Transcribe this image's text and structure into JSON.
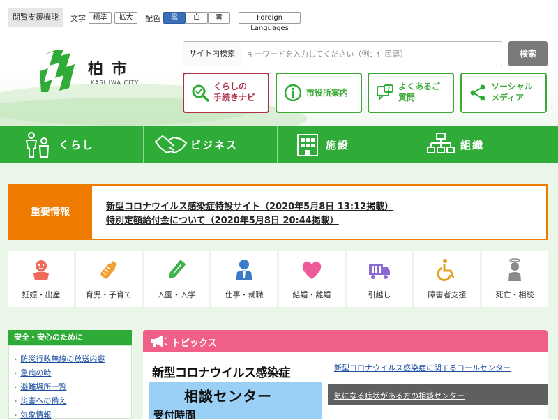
{
  "accessibility": {
    "title": "閲覧支援機能",
    "text_size_label": "文字",
    "text_size_buttons": [
      "標準",
      "拡大"
    ],
    "color_label": "配色",
    "color_buttons": [
      "黒",
      "白",
      "黄"
    ],
    "foreign_languages": "Foreign Languages",
    "selected_color": "黒"
  },
  "logo": {
    "name": "柏市",
    "subtitle": "KASHIWA CITY",
    "color": "#2fac37"
  },
  "search": {
    "label": "サイト内検索",
    "placeholder": "キーワードを入力してください（例：住民票）",
    "button": "検索"
  },
  "quick_nav": [
    {
      "label": "くらしの\n手続きナビ",
      "icon": "magnifier-check-icon"
    },
    {
      "label": "市役所案内",
      "icon": "info-icon"
    },
    {
      "label": "よくあるご\n質問",
      "icon": "question-bubble-icon"
    },
    {
      "label": "ソーシャル\nメディア",
      "icon": "share-icon"
    }
  ],
  "main_nav": [
    {
      "label": "くらし",
      "icon": "family-icon"
    },
    {
      "label": "ビジネス",
      "icon": "handshake-icon"
    },
    {
      "label": "施設",
      "icon": "building-icon"
    },
    {
      "label": "組織",
      "icon": "org-chart-icon"
    }
  ],
  "important": {
    "label": "重要情報",
    "links": [
      "新型コロナウイルス感染症特設サイト（2020年5月8日 13:12掲載）",
      "特別定額給付金について（2020年5月8日 20:44掲載）"
    ]
  },
  "life_categories": [
    {
      "label": "妊娠・出産",
      "icon": "baby-icon",
      "color": "#ef6a5a"
    },
    {
      "label": "育児・子育て",
      "icon": "baby-bottle-icon",
      "color": "#f0a030"
    },
    {
      "label": "入園・入学",
      "icon": "pencil-icon",
      "color": "#3cb34a"
    },
    {
      "label": "仕事・就職",
      "icon": "businessman-icon",
      "color": "#3a7cc8"
    },
    {
      "label": "結婚・離婚",
      "icon": "heart-icon",
      "color": "#ee5a9a"
    },
    {
      "label": "引越し",
      "icon": "truck-icon",
      "color": "#8a6ad0"
    },
    {
      "label": "障害者支援",
      "icon": "wheelchair-icon",
      "color": "#e0a020"
    },
    {
      "label": "死亡・相続",
      "icon": "angel-icon",
      "color": "#8a8a8a"
    }
  ],
  "safety": {
    "title": "安全・安心のために",
    "items": [
      "防災行政無線の放送内容",
      "急病の時",
      "避難場所一覧",
      "災害への備え",
      "気象情報"
    ]
  },
  "topics": {
    "title": "トピックス",
    "banner_lines": [
      "新型コロナウイルス感染症",
      "相談センター",
      "受付時間"
    ],
    "links": [
      "新型コロナウイルス感染症に関するコールセンター",
      "気になる症状がある方の相談センター"
    ]
  }
}
